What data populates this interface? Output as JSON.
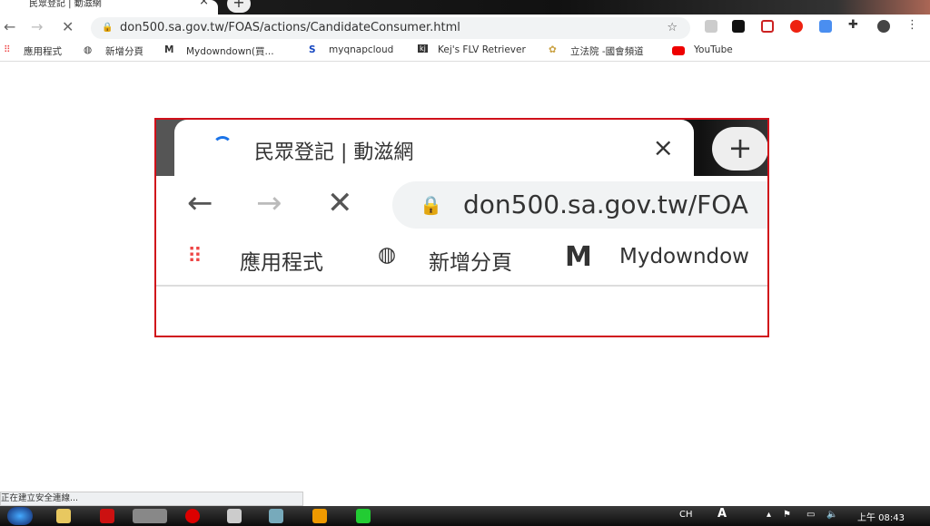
{
  "browser": {
    "tab_title": "民眾登記 | 動滋網",
    "url": "don500.sa.gov.tw/FOAS/actions/CandidateConsumer.html",
    "bookmarks": [
      "應用程式",
      "新增分頁",
      "Mydowndown(買...",
      "myqnapcloud",
      "Kej's FLV Retriever",
      "立法院 -國會頻道",
      "YouTube"
    ],
    "status_text": "正在建立安全連線..."
  },
  "callout": {
    "tab_title": "民眾登記 | 動滋網",
    "url": "don500.sa.gov.tw/FOA",
    "bookmarks": [
      "應用程式",
      "新增分頁",
      "Mydowndow"
    ],
    "border_color": "#d0101a"
  },
  "taskbar": {
    "ime": "CH",
    "clock": "上午 08:43"
  }
}
